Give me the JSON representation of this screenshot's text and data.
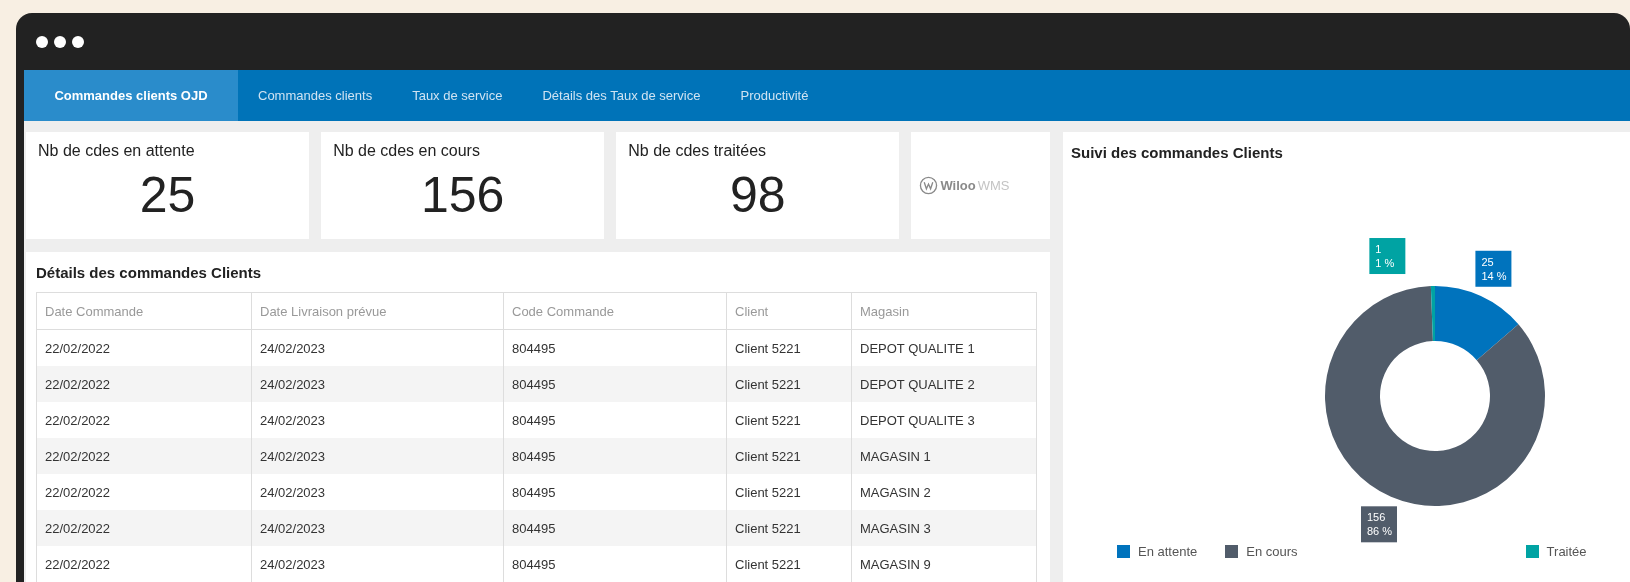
{
  "tabs": [
    {
      "label": "Commandes clients OJD",
      "selected": true
    },
    {
      "label": "Commandes clients",
      "selected": false
    },
    {
      "label": "Taux de service",
      "selected": false
    },
    {
      "label": "Détails des Taux de service",
      "selected": false
    },
    {
      "label": "Productivité",
      "selected": false
    }
  ],
  "kpis": [
    {
      "label": "Nb de cdes en attente",
      "value": "25"
    },
    {
      "label": "Nb de cdes en cours",
      "value": "156"
    },
    {
      "label": "Nb de cdes traitées",
      "value": "98"
    }
  ],
  "logo": {
    "name": "Wiloo",
    "suffix": "WMS"
  },
  "table": {
    "title": "Détails des commandes Clients",
    "columns": [
      "Date Commande",
      "Date Livraison prévue",
      "Code Commande",
      "Client",
      "Magasin"
    ],
    "rows": [
      [
        "22/02/2022",
        "24/02/2023",
        "804495",
        "Client 5221",
        "DEPOT QUALITE 1"
      ],
      [
        "22/02/2022",
        "24/02/2023",
        "804495",
        "Client 5221",
        "DEPOT QUALITE 2"
      ],
      [
        "22/02/2022",
        "24/02/2023",
        "804495",
        "Client 5221",
        "DEPOT QUALITE 3"
      ],
      [
        "22/02/2022",
        "24/02/2023",
        "804495",
        "Client 5221",
        "MAGASIN 1"
      ],
      [
        "22/02/2022",
        "24/02/2023",
        "804495",
        "Client 5221",
        "MAGASIN 2"
      ],
      [
        "22/02/2022",
        "24/02/2023",
        "804495",
        "Client 5221",
        "MAGASIN 3"
      ],
      [
        "22/02/2022",
        "24/02/2023",
        "804495",
        "Client 5221",
        "MAGASIN 9"
      ]
    ]
  },
  "chart": {
    "title": "Suivi des commandes Clients",
    "chart_data": {
      "type": "donut",
      "categories": [
        "En attente",
        "En cours",
        "Traitée"
      ],
      "values": [
        13.7,
        85.7,
        0.6
      ],
      "colors": [
        "#0073bd",
        "#515c6a",
        "#00a3a3"
      ],
      "value_labels": [
        [
          "25",
          "14 %"
        ],
        [
          "156",
          "86 %"
        ],
        [
          "1",
          "1 %"
        ]
      ]
    }
  }
}
